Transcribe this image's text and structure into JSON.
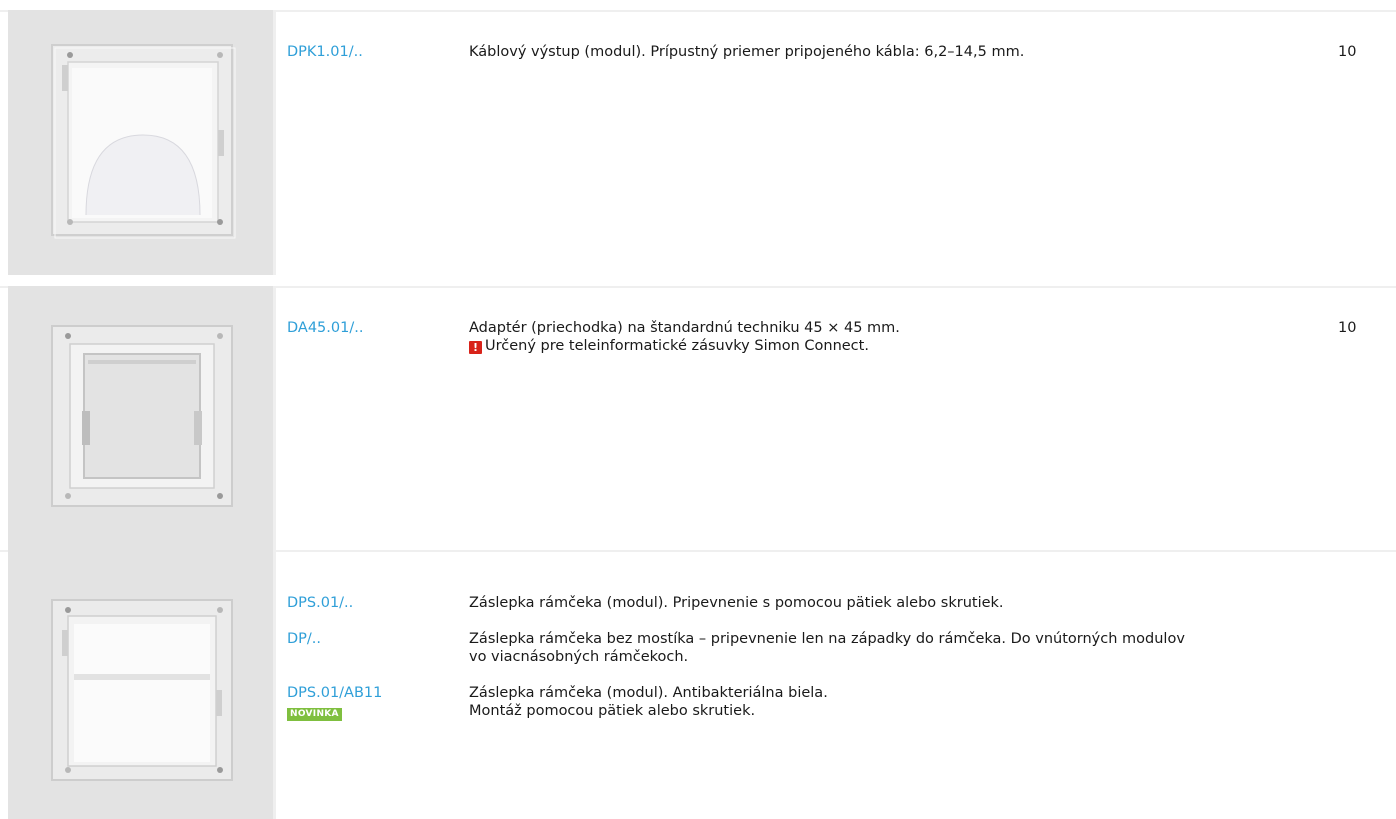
{
  "rows": [
    {
      "code": "DPK1.01/..",
      "description": "Káblový výstup (modul). Prípustný priemer pripojeného kábla: 6,2–14,5 mm.",
      "quantity": "10",
      "image_icon": "cable-outlet-module-image"
    },
    {
      "code": "DA45.01/..",
      "description": "Adaptér (priechodka) na štandardnú techniku 45 × 45 mm.",
      "note": "Určený pre teleinformatické zásuvky Simon Connect.",
      "note_icon": "exclamation-warning-icon",
      "warning_glyph": "!",
      "quantity": "10",
      "image_icon": "adapter-frame-image"
    },
    {
      "image_icon": "blank-plate-module-image",
      "items": [
        {
          "code": "DPS.01/..",
          "description": "Záslepka rámčeka (modul). Pripevnenie s pomocou pätiek alebo skrutiek."
        },
        {
          "code": "DP/..",
          "description_line1": "Záslepka rámčeka bez mostíka – pripevnenie len na západky do rámčeka. Do vnútorných modulov",
          "description_line2": "vo viacnásobných rámčekoch."
        },
        {
          "code": "DPS.01/AB11",
          "badge": "NOVINKA",
          "description_line1": "Záslepka rámčeka (modul). Antibakteriálna biela.",
          "description_line2": "Montáž pomocou pätiek alebo skrutiek."
        }
      ]
    }
  ],
  "colors": {
    "code_link": "#2f9fd8",
    "badge_bg": "#7fbf3f",
    "warning": "#d8231a",
    "image_bg": "#e3e3e3",
    "divider": "#efefef"
  }
}
